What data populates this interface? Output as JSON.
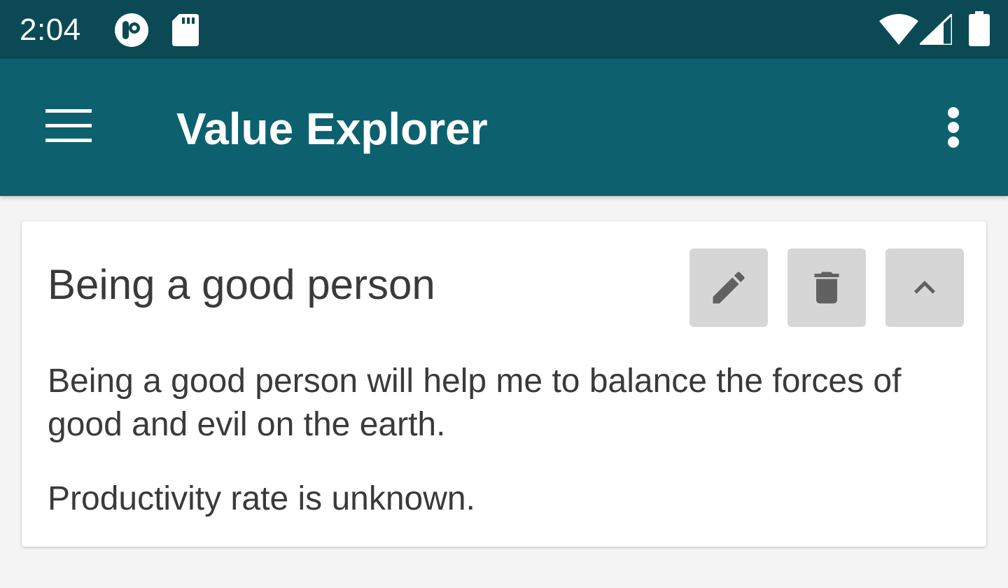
{
  "status_bar": {
    "time": "2:04",
    "icons": [
      "app-notification-icon",
      "sd-card-icon",
      "wifi-icon",
      "cellular-signal-icon",
      "battery-icon"
    ]
  },
  "app_bar": {
    "title": "Value Explorer",
    "menu_icon": "hamburger-menu-icon",
    "overflow_icon": "more-vert-icon",
    "background_color": "#0d616f",
    "status_color": "#0b4a55"
  },
  "value_card": {
    "title": "Being a good person",
    "description": "Being a good person will help me to balance the forces of good and evil on the earth.",
    "productivity": "Productivity rate is unknown.",
    "actions": [
      {
        "icon": "edit-pencil-icon"
      },
      {
        "icon": "delete-trash-icon"
      },
      {
        "icon": "collapse-chevron-up-icon"
      }
    ]
  }
}
